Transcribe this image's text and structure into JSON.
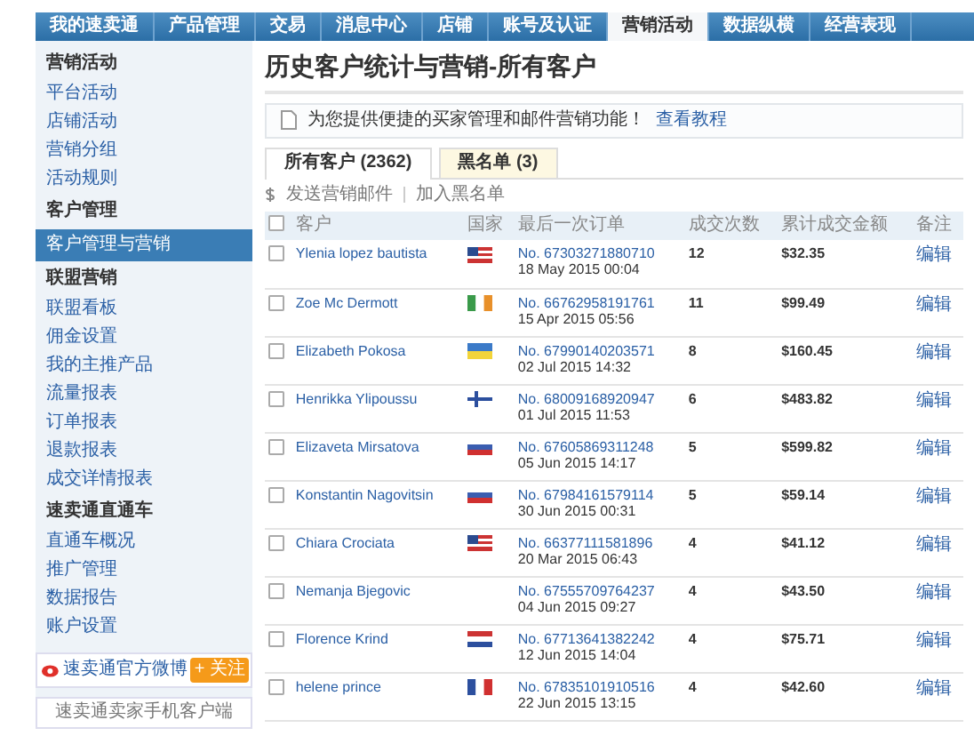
{
  "nav": [
    {
      "label": "我的速卖通",
      "selected": false
    },
    {
      "label": "产品管理",
      "selected": false
    },
    {
      "label": "交易",
      "selected": false
    },
    {
      "label": "消息中心",
      "selected": false
    },
    {
      "label": "店铺",
      "selected": false
    },
    {
      "label": "账号及认证",
      "selected": false
    },
    {
      "label": "营销活动",
      "selected": true
    },
    {
      "label": "数据纵横",
      "selected": false
    },
    {
      "label": "经营表现",
      "selected": false
    }
  ],
  "sidebar": {
    "sections": [
      {
        "title": "营销活动",
        "items": [
          {
            "label": "平台活动",
            "selected": false
          },
          {
            "label": "店铺活动",
            "selected": false
          },
          {
            "label": "营销分组",
            "selected": false
          },
          {
            "label": "活动规则",
            "selected": false
          }
        ]
      },
      {
        "title": "客户管理",
        "items": [
          {
            "label": "客户管理与营销",
            "selected": true
          }
        ]
      },
      {
        "title": "联盟营销",
        "items": [
          {
            "label": "联盟看板",
            "selected": false
          },
          {
            "label": "佣金设置",
            "selected": false
          },
          {
            "label": "我的主推产品",
            "selected": false
          },
          {
            "label": "流量报表",
            "selected": false
          },
          {
            "label": "订单报表",
            "selected": false
          },
          {
            "label": "退款报表",
            "selected": false
          },
          {
            "label": "成交详情报表",
            "selected": false
          }
        ]
      },
      {
        "title": "速卖通直通车",
        "items": [
          {
            "label": "直通车概况",
            "selected": false
          },
          {
            "label": "推广管理",
            "selected": false
          },
          {
            "label": "数据报告",
            "selected": false
          },
          {
            "label": "账户设置",
            "selected": false
          }
        ]
      }
    ],
    "weibo": {
      "label": "速卖通官方微博",
      "button": "+ 关注"
    },
    "app_promo": "速卖通卖家手机客户端"
  },
  "page_title": "历史客户统计与营销-所有客户",
  "notice": {
    "text": "为您提供便捷的买家管理和邮件营销功能！",
    "link": "查看教程"
  },
  "tabs": [
    {
      "label": "所有客户 (2362)",
      "selected": true
    },
    {
      "label": "黑名单 (3)",
      "selected": false
    }
  ],
  "actions": [
    "发送营销邮件",
    "加入黑名单"
  ],
  "table": {
    "all_checked": false,
    "columns": [
      "客户",
      "国家",
      "最后一次订单",
      "成交次数",
      "累计成交金额",
      "备注"
    ],
    "rows": [
      {
        "checked": false,
        "name": "Ylenia lopez bautista",
        "kind": "us",
        "order": "No. 67303271880710",
        "date": "18 May 2015 00:04",
        "count": "12",
        "amount": "$32.35",
        "note": "编辑"
      },
      {
        "checked": false,
        "name": "Zoe Mc Dermott",
        "kind": "ie",
        "order": "No. 66762958191761",
        "date": "15 Apr 2015 05:56",
        "count": "11",
        "amount": "$99.49",
        "note": "编辑"
      },
      {
        "checked": false,
        "name": "Elizabeth Pokosa",
        "kind": "ua",
        "order": "No. 67990140203571",
        "date": "02 Jul 2015 14:32",
        "count": "8",
        "amount": "$160.45",
        "note": "编辑"
      },
      {
        "checked": false,
        "name": "Henrikka Ylipoussu",
        "kind": "fi",
        "order": "No. 68009168920947",
        "date": "01 Jul 2015 11:53",
        "count": "6",
        "amount": "$483.82",
        "note": "编辑"
      },
      {
        "checked": false,
        "name": "Elizaveta Mirsatova",
        "kind": "ru",
        "order": "No. 67605869311248",
        "date": "05 Jun 2015 14:17",
        "count": "5",
        "amount": "$599.82",
        "note": "编辑"
      },
      {
        "checked": false,
        "name": "Konstantin Nagovitsin",
        "kind": "ru",
        "order": "No. 67984161579114",
        "date": "30 Jun 2015 00:31",
        "count": "5",
        "amount": "$59.14",
        "note": "编辑"
      },
      {
        "checked": false,
        "name": "Chiara Crociata",
        "kind": "us",
        "order": "No. 66377111581896",
        "date": "20 Mar 2015 06:43",
        "count": "4",
        "amount": "$41.12",
        "note": "编辑"
      },
      {
        "checked": false,
        "name": "Nemanja Bjegovic",
        "kind": "blank",
        "order": "No. 67555709764237",
        "date": "04 Jun 2015 09:27",
        "count": "4",
        "amount": "$43.50",
        "note": "编辑"
      },
      {
        "checked": false,
        "name": "Florence Krind",
        "kind": "nl",
        "order": "No. 67713641382242",
        "date": "12 Jun 2015 14:04",
        "count": "4",
        "amount": "$75.71",
        "note": "编辑"
      },
      {
        "checked": false,
        "name": "helene prince",
        "kind": "fr",
        "order": "No. 67835101910516",
        "date": "22 Jun 2015 13:15",
        "count": "4",
        "amount": "$42.60",
        "note": "编辑"
      }
    ]
  }
}
